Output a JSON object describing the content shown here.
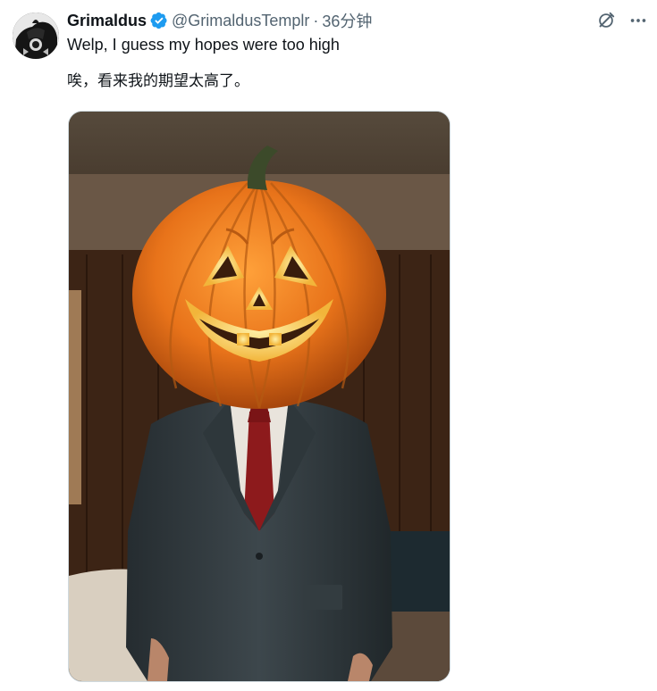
{
  "tweet": {
    "display_name": "Grimaldus",
    "handle": "@GrimaldusTemplr",
    "separator": "·",
    "time": "36分钟",
    "text_en": "Welp, I guess my hopes were too high",
    "text_zh": "唉，看来我的期望太高了。",
    "verified": true,
    "media": {
      "subject": "person in a dark suit and red tie with a carved jack-o'-lantern pumpkin head, in a wood-paneled 1970s room"
    }
  },
  "icons": {
    "avatar": "avatar-image",
    "verified": "verified-badge-icon",
    "grok": "grok-icon",
    "more": "more-icon"
  },
  "colors": {
    "text_primary": "#0f1419",
    "text_secondary": "#536471",
    "verified_blue": "#1d9bf0"
  }
}
